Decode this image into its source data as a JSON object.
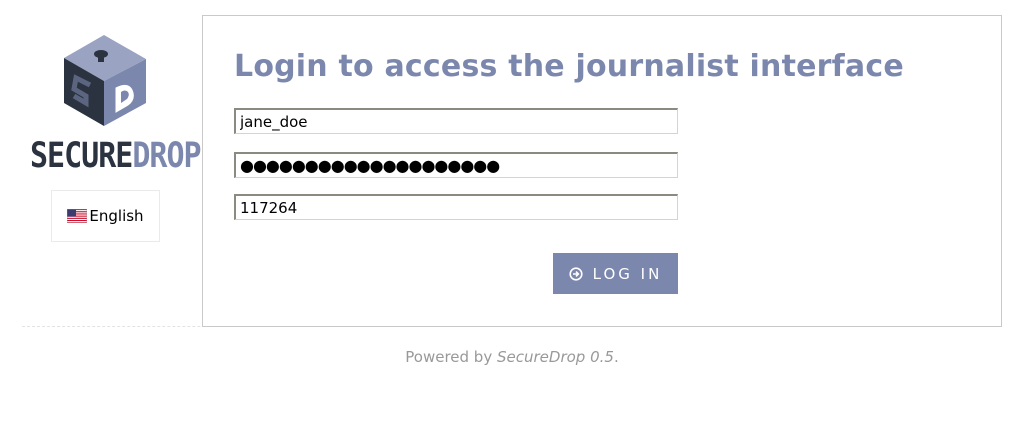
{
  "brand": {
    "name_part1": "SECURE",
    "name_part2": "DROP",
    "colors": {
      "dark": "#2b3340",
      "accent": "#7b87ad"
    }
  },
  "language": {
    "label": "English",
    "flag_icon": "us-flag-icon"
  },
  "login": {
    "title": "Login to access the journalist interface",
    "username_value": "jane_doe",
    "password_value": "●●●●●●●●●●●●●●●●●●●●",
    "otp_value": "117264",
    "button_label": "LOG IN",
    "button_icon": "arrow-circle-right-icon"
  },
  "footer": {
    "prefix": "Powered by",
    "product": "SecureDrop 0.5",
    "suffix": "."
  }
}
